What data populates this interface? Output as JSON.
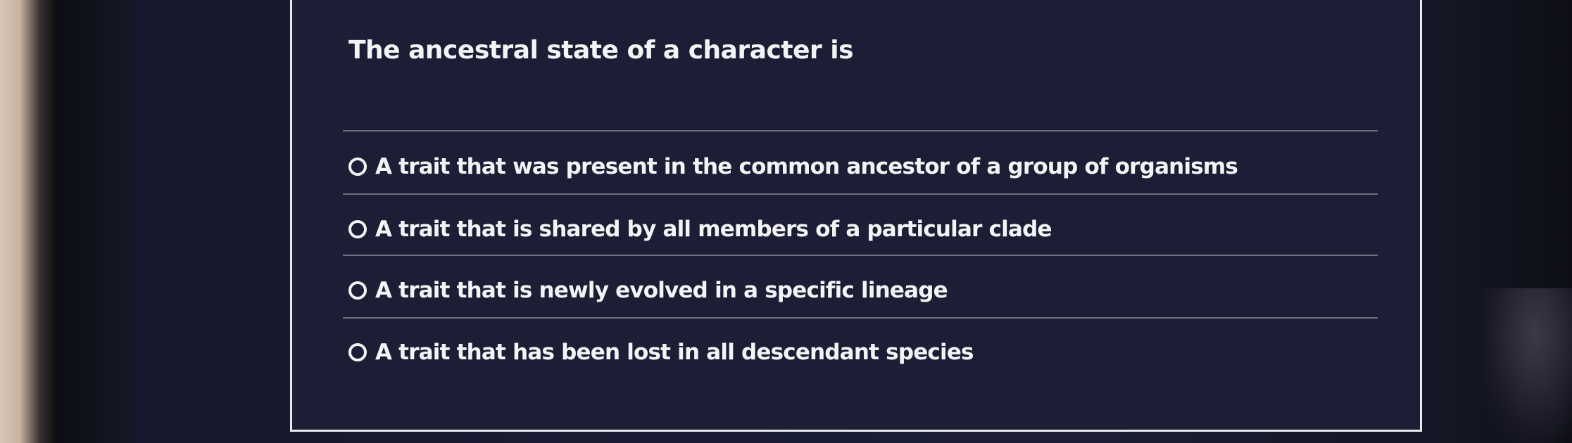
{
  "quiz": {
    "question": "The ancestral state of a character is",
    "options": [
      {
        "label": "A trait that was present in the common ancestor of a group of organisms",
        "selected": false
      },
      {
        "label": "A trait that is shared by all members of a particular clade",
        "selected": false
      },
      {
        "label": "A trait that is newly evolved in a specific lineage",
        "selected": false
      },
      {
        "label": "A trait that has been lost in all descendant species",
        "selected": false
      }
    ]
  }
}
